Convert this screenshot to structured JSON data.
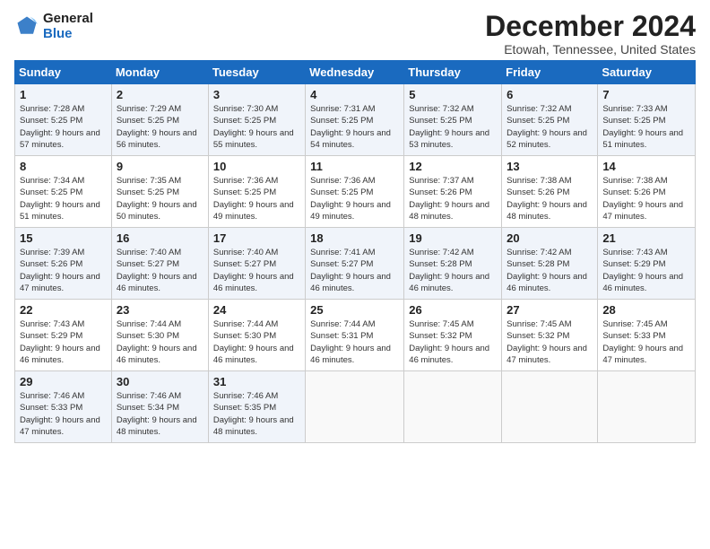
{
  "logo": {
    "line1": "General",
    "line2": "Blue"
  },
  "title": "December 2024",
  "subtitle": "Etowah, Tennessee, United States",
  "days_header": [
    "Sunday",
    "Monday",
    "Tuesday",
    "Wednesday",
    "Thursday",
    "Friday",
    "Saturday"
  ],
  "weeks": [
    [
      {
        "day": "1",
        "sunrise": "Sunrise: 7:28 AM",
        "sunset": "Sunset: 5:25 PM",
        "daylight": "Daylight: 9 hours and 57 minutes."
      },
      {
        "day": "2",
        "sunrise": "Sunrise: 7:29 AM",
        "sunset": "Sunset: 5:25 PM",
        "daylight": "Daylight: 9 hours and 56 minutes."
      },
      {
        "day": "3",
        "sunrise": "Sunrise: 7:30 AM",
        "sunset": "Sunset: 5:25 PM",
        "daylight": "Daylight: 9 hours and 55 minutes."
      },
      {
        "day": "4",
        "sunrise": "Sunrise: 7:31 AM",
        "sunset": "Sunset: 5:25 PM",
        "daylight": "Daylight: 9 hours and 54 minutes."
      },
      {
        "day": "5",
        "sunrise": "Sunrise: 7:32 AM",
        "sunset": "Sunset: 5:25 PM",
        "daylight": "Daylight: 9 hours and 53 minutes."
      },
      {
        "day": "6",
        "sunrise": "Sunrise: 7:32 AM",
        "sunset": "Sunset: 5:25 PM",
        "daylight": "Daylight: 9 hours and 52 minutes."
      },
      {
        "day": "7",
        "sunrise": "Sunrise: 7:33 AM",
        "sunset": "Sunset: 5:25 PM",
        "daylight": "Daylight: 9 hours and 51 minutes."
      }
    ],
    [
      {
        "day": "8",
        "sunrise": "Sunrise: 7:34 AM",
        "sunset": "Sunset: 5:25 PM",
        "daylight": "Daylight: 9 hours and 51 minutes."
      },
      {
        "day": "9",
        "sunrise": "Sunrise: 7:35 AM",
        "sunset": "Sunset: 5:25 PM",
        "daylight": "Daylight: 9 hours and 50 minutes."
      },
      {
        "day": "10",
        "sunrise": "Sunrise: 7:36 AM",
        "sunset": "Sunset: 5:25 PM",
        "daylight": "Daylight: 9 hours and 49 minutes."
      },
      {
        "day": "11",
        "sunrise": "Sunrise: 7:36 AM",
        "sunset": "Sunset: 5:25 PM",
        "daylight": "Daylight: 9 hours and 49 minutes."
      },
      {
        "day": "12",
        "sunrise": "Sunrise: 7:37 AM",
        "sunset": "Sunset: 5:26 PM",
        "daylight": "Daylight: 9 hours and 48 minutes."
      },
      {
        "day": "13",
        "sunrise": "Sunrise: 7:38 AM",
        "sunset": "Sunset: 5:26 PM",
        "daylight": "Daylight: 9 hours and 48 minutes."
      },
      {
        "day": "14",
        "sunrise": "Sunrise: 7:38 AM",
        "sunset": "Sunset: 5:26 PM",
        "daylight": "Daylight: 9 hours and 47 minutes."
      }
    ],
    [
      {
        "day": "15",
        "sunrise": "Sunrise: 7:39 AM",
        "sunset": "Sunset: 5:26 PM",
        "daylight": "Daylight: 9 hours and 47 minutes."
      },
      {
        "day": "16",
        "sunrise": "Sunrise: 7:40 AM",
        "sunset": "Sunset: 5:27 PM",
        "daylight": "Daylight: 9 hours and 46 minutes."
      },
      {
        "day": "17",
        "sunrise": "Sunrise: 7:40 AM",
        "sunset": "Sunset: 5:27 PM",
        "daylight": "Daylight: 9 hours and 46 minutes."
      },
      {
        "day": "18",
        "sunrise": "Sunrise: 7:41 AM",
        "sunset": "Sunset: 5:27 PM",
        "daylight": "Daylight: 9 hours and 46 minutes."
      },
      {
        "day": "19",
        "sunrise": "Sunrise: 7:42 AM",
        "sunset": "Sunset: 5:28 PM",
        "daylight": "Daylight: 9 hours and 46 minutes."
      },
      {
        "day": "20",
        "sunrise": "Sunrise: 7:42 AM",
        "sunset": "Sunset: 5:28 PM",
        "daylight": "Daylight: 9 hours and 46 minutes."
      },
      {
        "day": "21",
        "sunrise": "Sunrise: 7:43 AM",
        "sunset": "Sunset: 5:29 PM",
        "daylight": "Daylight: 9 hours and 46 minutes."
      }
    ],
    [
      {
        "day": "22",
        "sunrise": "Sunrise: 7:43 AM",
        "sunset": "Sunset: 5:29 PM",
        "daylight": "Daylight: 9 hours and 46 minutes."
      },
      {
        "day": "23",
        "sunrise": "Sunrise: 7:44 AM",
        "sunset": "Sunset: 5:30 PM",
        "daylight": "Daylight: 9 hours and 46 minutes."
      },
      {
        "day": "24",
        "sunrise": "Sunrise: 7:44 AM",
        "sunset": "Sunset: 5:30 PM",
        "daylight": "Daylight: 9 hours and 46 minutes."
      },
      {
        "day": "25",
        "sunrise": "Sunrise: 7:44 AM",
        "sunset": "Sunset: 5:31 PM",
        "daylight": "Daylight: 9 hours and 46 minutes."
      },
      {
        "day": "26",
        "sunrise": "Sunrise: 7:45 AM",
        "sunset": "Sunset: 5:32 PM",
        "daylight": "Daylight: 9 hours and 46 minutes."
      },
      {
        "day": "27",
        "sunrise": "Sunrise: 7:45 AM",
        "sunset": "Sunset: 5:32 PM",
        "daylight": "Daylight: 9 hours and 47 minutes."
      },
      {
        "day": "28",
        "sunrise": "Sunrise: 7:45 AM",
        "sunset": "Sunset: 5:33 PM",
        "daylight": "Daylight: 9 hours and 47 minutes."
      }
    ],
    [
      {
        "day": "29",
        "sunrise": "Sunrise: 7:46 AM",
        "sunset": "Sunset: 5:33 PM",
        "daylight": "Daylight: 9 hours and 47 minutes."
      },
      {
        "day": "30",
        "sunrise": "Sunrise: 7:46 AM",
        "sunset": "Sunset: 5:34 PM",
        "daylight": "Daylight: 9 hours and 48 minutes."
      },
      {
        "day": "31",
        "sunrise": "Sunrise: 7:46 AM",
        "sunset": "Sunset: 5:35 PM",
        "daylight": "Daylight: 9 hours and 48 minutes."
      },
      null,
      null,
      null,
      null
    ]
  ]
}
